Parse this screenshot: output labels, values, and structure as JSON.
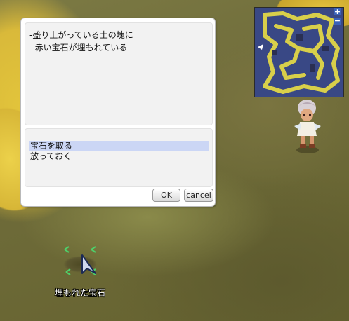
{
  "dialog": {
    "message_lines": [
      "-盛り上がっている土の塊に",
      "  赤い宝石が埋もれている-"
    ],
    "options": [
      {
        "label": "宝石を取る",
        "selected": true
      },
      {
        "label": "放っておく",
        "selected": false
      }
    ],
    "ok_label": "OK",
    "cancel_label": "cancel"
  },
  "minimap": {
    "zoom_in_label": "+",
    "zoom_out_label": "−"
  },
  "world": {
    "gem_label": "埋もれた宝石"
  },
  "colors": {
    "dialog_bg": "#ffffff",
    "panel_bg": "#f2f2f2",
    "selection": "#cbd6f5",
    "minimap_path": "#d8cf4a",
    "minimap_wall": "#3a4a86"
  }
}
